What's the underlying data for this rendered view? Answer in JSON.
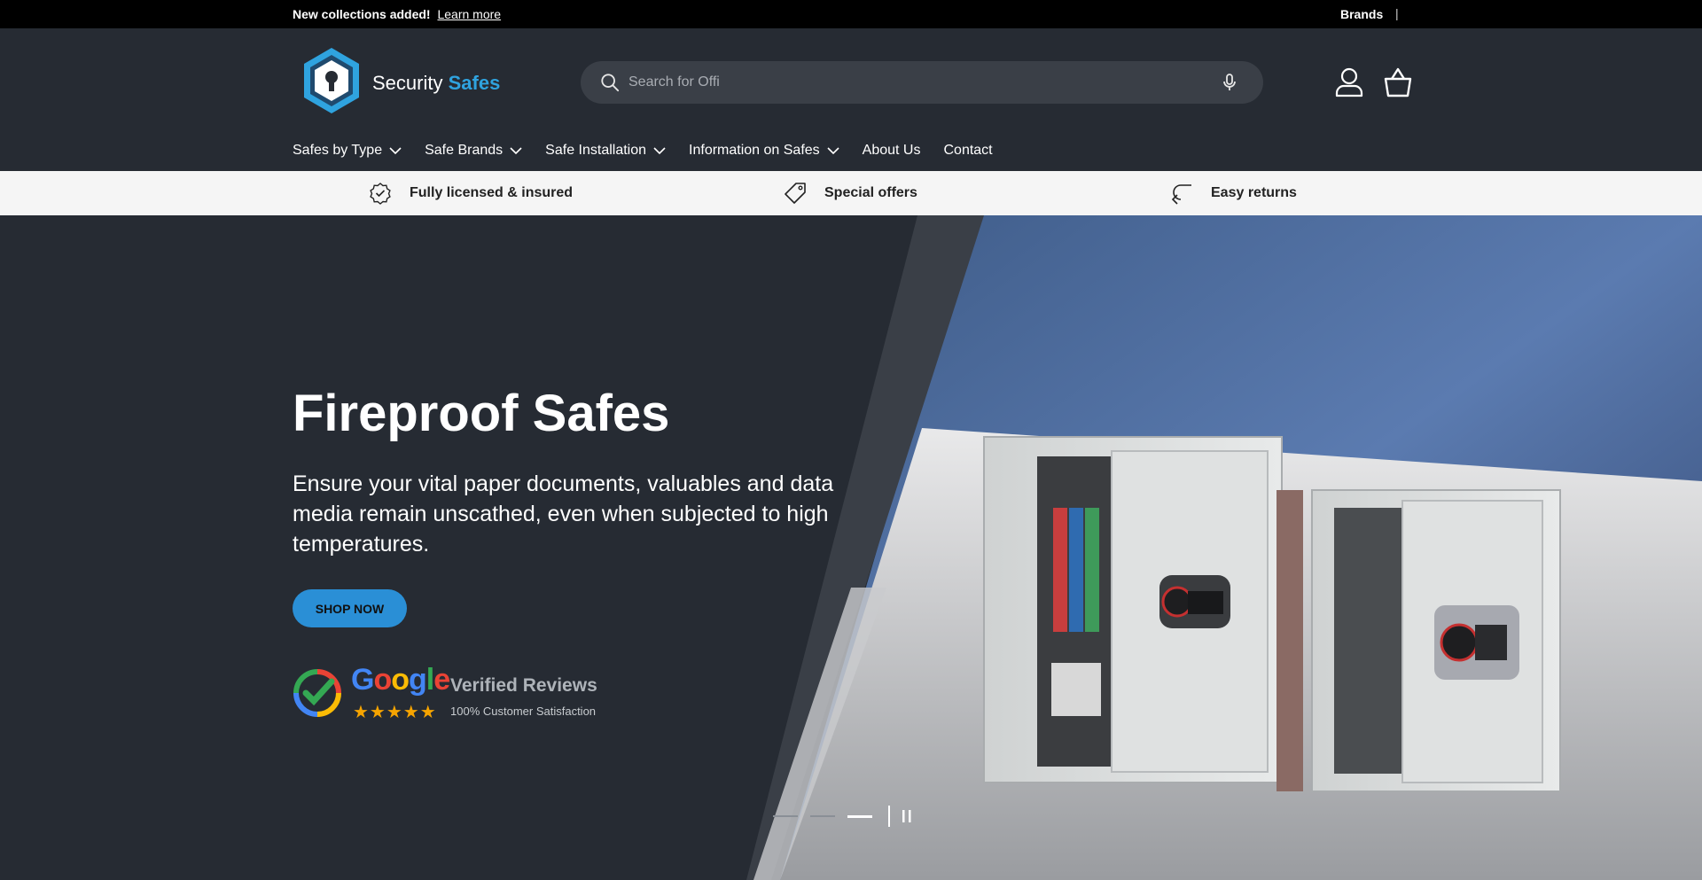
{
  "announcement": {
    "message": "New collections added!",
    "link": "Learn more",
    "right_link": "Brands",
    "separator": "|"
  },
  "header": {
    "logo": {
      "word1": "Security",
      "word2": "Safes"
    },
    "search": {
      "placeholder": "Search for Offi"
    },
    "nav": [
      {
        "label": "Safes by Type",
        "has_dropdown": true
      },
      {
        "label": "Safe Brands",
        "has_dropdown": true
      },
      {
        "label": "Safe Installation",
        "has_dropdown": true
      },
      {
        "label": "Information on Safes",
        "has_dropdown": true
      },
      {
        "label": "About Us",
        "has_dropdown": false
      },
      {
        "label": "Contact",
        "has_dropdown": false
      }
    ]
  },
  "usp": [
    {
      "icon": "verified-badge-icon",
      "label": "Fully licensed & insured"
    },
    {
      "icon": "price-tag-icon",
      "label": "Special offers"
    },
    {
      "icon": "return-arrow-icon",
      "label": "Easy returns"
    }
  ],
  "hero": {
    "title": "Fireproof Safes",
    "subtitle": "Ensure your vital paper documents, valuables and data media remain unscathed, even when subjected to high temperatures.",
    "button": "SHOP NOW",
    "reviews": {
      "brand": "Google",
      "verified": "Verified Reviews",
      "stars": "★★★★★",
      "satisfaction": "100% Customer Satisfaction",
      "rating": 5
    },
    "slides": {
      "count": 3,
      "active": 3
    }
  },
  "colors": {
    "header_bg": "#262b33",
    "accent": "#2fa3df",
    "button": "#2a8fd6",
    "usp_bg": "#f5f5f5",
    "announce_bg": "#000000"
  }
}
